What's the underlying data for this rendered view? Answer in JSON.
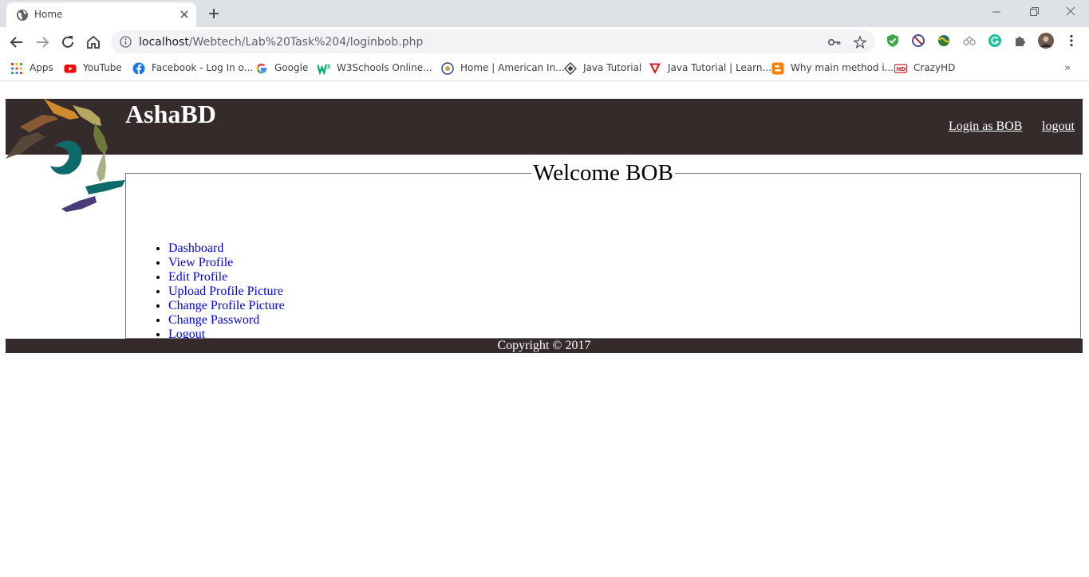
{
  "browser": {
    "tab_title": "Home",
    "url_host": "localhost",
    "url_path": "/Webtech/Lab%20Task%204/loginbob.php"
  },
  "bookmarks": [
    {
      "label": "Apps",
      "icon": "apps-grid-icon"
    },
    {
      "label": "YouTube",
      "icon": "youtube-icon"
    },
    {
      "label": "Facebook - Log In o...",
      "icon": "facebook-icon"
    },
    {
      "label": "Google",
      "icon": "google-icon"
    },
    {
      "label": "W3Schools Online...",
      "icon": "w3schools-icon"
    },
    {
      "label": "Home | American In...",
      "icon": "american-icon"
    },
    {
      "label": "Java Tutorial",
      "icon": "java-diamond-icon"
    },
    {
      "label": "Java Tutorial | Learn...",
      "icon": "java-triangle-icon"
    },
    {
      "label": "Why main method i...",
      "icon": "blogger-icon"
    },
    {
      "label": "CrazyHD",
      "icon": "crazyhd-icon"
    }
  ],
  "bookmarks_more": "»",
  "page": {
    "site_title": "AshaBD",
    "header_links": {
      "login": "Login as BOB",
      "logout": "logout"
    },
    "welcome_legend": "Welcome BOB",
    "menu": [
      "Dashboard",
      "View Profile",
      "Edit Profile",
      "Upload Profile Picture",
      "Change Profile Picture",
      "Change Password",
      "Logout"
    ],
    "footer": "Copyright © 2017"
  },
  "colors": {
    "header_bg": "#352b2b",
    "link": "#0000ee",
    "tabstrip_bg": "#dee1e6"
  }
}
